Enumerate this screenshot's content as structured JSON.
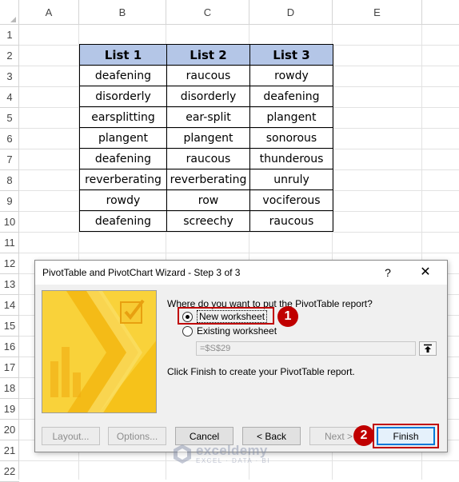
{
  "sheet": {
    "columns": [
      "A",
      "B",
      "C",
      "D",
      "E"
    ],
    "rows": [
      "1",
      "2",
      "3",
      "4",
      "5",
      "6",
      "7",
      "8",
      "9",
      "10",
      "11",
      "12",
      "13",
      "14",
      "15",
      "16",
      "17",
      "18",
      "19",
      "20",
      "21",
      "22"
    ]
  },
  "table": {
    "headers": [
      "List 1",
      "List 2",
      "List 3"
    ],
    "rows": [
      [
        "deafening",
        "raucous",
        "rowdy"
      ],
      [
        "disorderly",
        "disorderly",
        "deafening"
      ],
      [
        "earsplitting",
        "ear-split",
        "plangent"
      ],
      [
        "plangent",
        "plangent",
        "sonorous"
      ],
      [
        "deafening",
        "raucous",
        "thunderous"
      ],
      [
        "reverberating",
        "reverberating",
        "unruly"
      ],
      [
        "rowdy",
        "row",
        "vociferous"
      ],
      [
        "deafening",
        "screechy",
        "raucous"
      ]
    ],
    "header_color": "#b4c6e7"
  },
  "dialog": {
    "title": "PivotTable and PivotChart Wizard - Step 3 of 3",
    "help": "?",
    "close": "✕",
    "prompt": "Where do you want to put the PivotTable report?",
    "option_new": "New worksheet",
    "option_existing": "Existing worksheet",
    "selected": "New worksheet",
    "location_value": "=$S$29",
    "finish_note": "Click Finish to create your PivotTable report.",
    "buttons": {
      "layout": "Layout...",
      "options": "Options...",
      "cancel": "Cancel",
      "back": "< Back",
      "next": "Next >",
      "finish": "Finish"
    }
  },
  "annotations": {
    "badge1": "1",
    "badge2": "2",
    "color": "#c00000"
  },
  "watermark": {
    "name": "exceldemy",
    "tagline": "EXCEL · DATA · BI"
  }
}
